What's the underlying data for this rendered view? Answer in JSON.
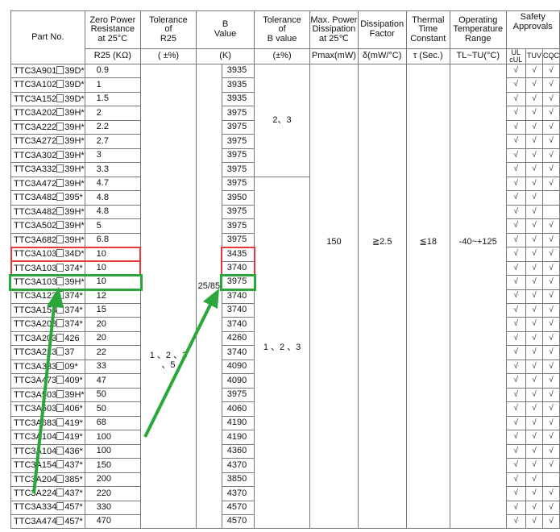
{
  "headers": {
    "part_no": "Part No.",
    "resistance": [
      "Zero Power",
      "Resistance",
      "at 25°C"
    ],
    "tol_r": [
      "Tolerance",
      "of",
      "R25"
    ],
    "b_value": [
      "B",
      "Value"
    ],
    "tol_b": [
      "Tolerance",
      "of",
      "B value"
    ],
    "max_power": [
      "Max. Power",
      "Dissipation",
      "at 25℃"
    ],
    "diss_factor": [
      "Dissipation",
      "Factor"
    ],
    "thermal": [
      "Thermal",
      "Time",
      "Constant"
    ],
    "op_temp": [
      "Operating",
      "Temperature",
      "Range"
    ],
    "safety": [
      "Safety",
      "Approvals"
    ],
    "ul": [
      "UL",
      "cUL"
    ],
    "tuv": "TUV",
    "cqc": "CQC"
  },
  "units": {
    "resistance": "R25 (KΩ)",
    "tol_r": "( ±%)",
    "b_value": "(K)",
    "tol_b": "(±%)",
    "max_power": "Pmax(mW)",
    "diss_factor": "δ(mW/°C)",
    "thermal": "τ (Sec.)",
    "op_temp": "TL~TU(°C)"
  },
  "merged": {
    "tol_r": "1 、2 、3 、5",
    "b_condition": "25/85",
    "tol_b_top": "2、3",
    "tol_b_bottom": "1 、2 、3",
    "max_power": "150",
    "diss_factor": "≧2.5",
    "thermal": "≦18",
    "op_temp": "-40~+125"
  },
  "check_mark": "√",
  "rows": [
    {
      "pre": "TTC3A901",
      "suf": "39D*",
      "r": "0.9",
      "b": "3935",
      "ul": true,
      "tuv": true,
      "cqc": true
    },
    {
      "pre": "TTC3A102",
      "suf": "39D*",
      "r": "1",
      "b": "3935",
      "ul": true,
      "tuv": true,
      "cqc": true
    },
    {
      "pre": "TTC3A152",
      "suf": "39D*",
      "r": "1.5",
      "b": "3935",
      "ul": true,
      "tuv": true,
      "cqc": true
    },
    {
      "pre": "TTC3A202",
      "suf": "39H*",
      "r": "2",
      "b": "3975",
      "ul": true,
      "tuv": true,
      "cqc": true
    },
    {
      "pre": "TTC3A222",
      "suf": "39H*",
      "r": "2.2",
      "b": "3975",
      "ul": true,
      "tuv": true,
      "cqc": true
    },
    {
      "pre": "TTC3A272",
      "suf": "39H*",
      "r": "2.7",
      "b": "3975",
      "ul": true,
      "tuv": true,
      "cqc": true
    },
    {
      "pre": "TTC3A302",
      "suf": "39H*",
      "r": "3",
      "b": "3975",
      "ul": true,
      "tuv": true,
      "cqc": true
    },
    {
      "pre": "TTC3A332",
      "suf": "39H*",
      "r": "3.3",
      "b": "3975",
      "ul": true,
      "tuv": true,
      "cqc": true
    },
    {
      "pre": "TTC3A472",
      "suf": "39H*",
      "r": "4.7",
      "b": "3975",
      "ul": true,
      "tuv": true,
      "cqc": true
    },
    {
      "pre": "TTC3A482",
      "suf": "395*",
      "r": "4.8",
      "b": "3950",
      "ul": true,
      "tuv": true,
      "cqc": false
    },
    {
      "pre": "TTC3A482",
      "suf": "39H*",
      "r": "4.8",
      "b": "3975",
      "ul": true,
      "tuv": true,
      "cqc": false
    },
    {
      "pre": "TTC3A502",
      "suf": "39H*",
      "r": "5",
      "b": "3975",
      "ul": true,
      "tuv": true,
      "cqc": true
    },
    {
      "pre": "TTC3A682",
      "suf": "39H*",
      "r": "6.8",
      "b": "3975",
      "ul": true,
      "tuv": true,
      "cqc": true
    },
    {
      "pre": "TTC3A103",
      "suf": "34D*",
      "r": "10",
      "b": "3435",
      "ul": true,
      "tuv": true,
      "cqc": true
    },
    {
      "pre": "TTC3A103",
      "suf": "374*",
      "r": "10",
      "b": "3740",
      "ul": true,
      "tuv": true,
      "cqc": true
    },
    {
      "pre": "TTC3A103",
      "suf": "39H*",
      "r": "10",
      "b": "3975",
      "ul": true,
      "tuv": true,
      "cqc": true
    },
    {
      "pre": "TTC3A123",
      "suf": "374*",
      "r": "12",
      "b": "3740",
      "ul": true,
      "tuv": true,
      "cqc": true
    },
    {
      "pre": "TTC3A153",
      "suf": "374*",
      "r": "15",
      "b": "3740",
      "ul": true,
      "tuv": true,
      "cqc": true
    },
    {
      "pre": "TTC3A203",
      "suf": "374*",
      "r": "20",
      "b": "3740",
      "ul": true,
      "tuv": true,
      "cqc": true
    },
    {
      "pre": "TTC3A203",
      "suf": "426",
      "r": "20",
      "b": "4260",
      "ul": true,
      "tuv": true,
      "cqc": true
    },
    {
      "pre": "TTC3A223",
      "suf": "37",
      "r": "22",
      "b": "3740",
      "ul": true,
      "tuv": true,
      "cqc": true
    },
    {
      "pre": "TTC3A333",
      "suf": "09*",
      "r": "33",
      "b": "4090",
      "ul": true,
      "tuv": true,
      "cqc": true
    },
    {
      "pre": "TTC3A473",
      "suf": "409*",
      "r": "47",
      "b": "4090",
      "ul": true,
      "tuv": true,
      "cqc": true
    },
    {
      "pre": "TTC3A503",
      "suf": "39H*",
      "r": "50",
      "b": "3975",
      "ul": true,
      "tuv": true,
      "cqc": true
    },
    {
      "pre": "TTC3A503",
      "suf": "406*",
      "r": "50",
      "b": "4060",
      "ul": true,
      "tuv": true,
      "cqc": true
    },
    {
      "pre": "TTC3A683",
      "suf": "419*",
      "r": "68",
      "b": "4190",
      "ul": true,
      "tuv": true,
      "cqc": true
    },
    {
      "pre": "TTC3A104",
      "suf": "419*",
      "r": "100",
      "b": "4190",
      "ul": true,
      "tuv": true,
      "cqc": true
    },
    {
      "pre": "TTC3A104",
      "suf": "436*",
      "r": "100",
      "b": "4360",
      "ul": true,
      "tuv": true,
      "cqc": true
    },
    {
      "pre": "TTC3A154",
      "suf": "437*",
      "r": "150",
      "b": "4370",
      "ul": true,
      "tuv": true,
      "cqc": true
    },
    {
      "pre": "TTC3A204",
      "suf": "385*",
      "r": "200",
      "b": "3850",
      "ul": true,
      "tuv": true,
      "cqc": false
    },
    {
      "pre": "TTC3A224",
      "suf": "437*",
      "r": "220",
      "b": "4370",
      "ul": true,
      "tuv": true,
      "cqc": true
    },
    {
      "pre": "TTC3A334",
      "suf": "457*",
      "r": "330",
      "b": "4570",
      "ul": true,
      "tuv": true,
      "cqc": true
    },
    {
      "pre": "TTC3A474",
      "suf": "457*",
      "r": "470",
      "b": "4570",
      "ul": true,
      "tuv": true,
      "cqc": true
    }
  ],
  "annotations": {
    "red_color": "#e8373a",
    "green_color": "#2aa73a",
    "red_rows": [
      13,
      14
    ],
    "green_row": 15
  }
}
